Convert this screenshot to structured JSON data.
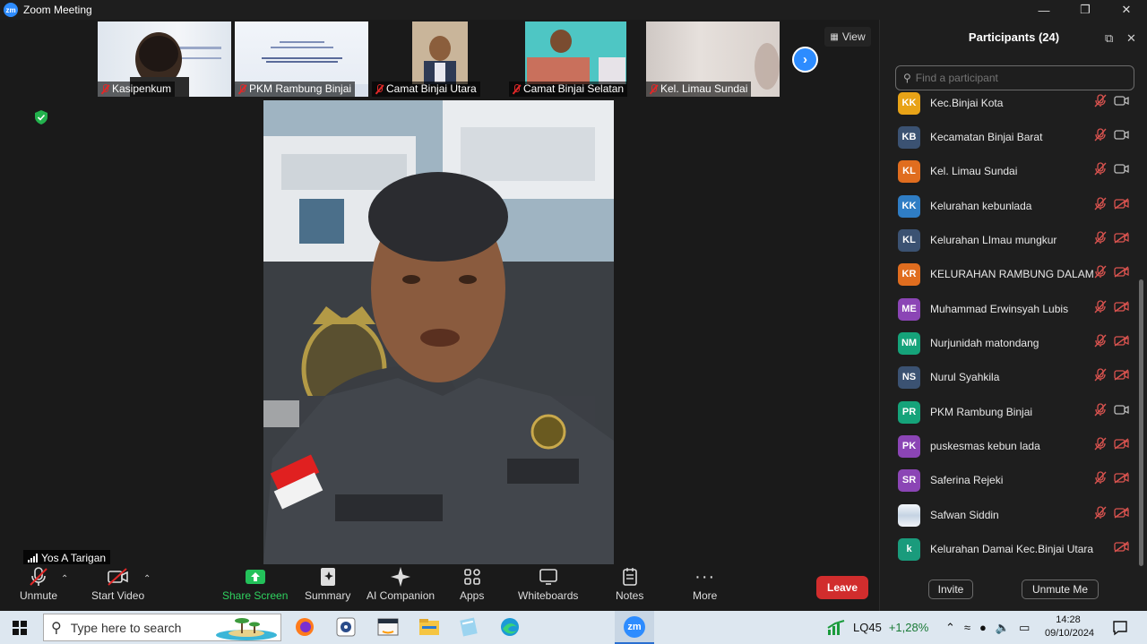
{
  "window": {
    "title": "Zoom Meeting",
    "app_logo": "zm"
  },
  "thumbnails": [
    {
      "name": "Kasipenkum"
    },
    {
      "name": "PKM Rambung Binjai"
    },
    {
      "name": "Camat Binjai Utara"
    },
    {
      "name": "Camat Binjai Selatan"
    },
    {
      "name": "Kel. Limau Sundai"
    }
  ],
  "view_button": {
    "label": "View"
  },
  "main_speaker": {
    "name": "Yos A Tarigan"
  },
  "toolbar": {
    "unmute": "Unmute",
    "start_video": "Start Video",
    "share_screen": "Share Screen",
    "summary": "Summary",
    "ai_companion": "AI Companion",
    "apps": "Apps",
    "whiteboards": "Whiteboards",
    "notes": "Notes",
    "more": "More",
    "leave": "Leave"
  },
  "participants_panel": {
    "title": "Participants (24)",
    "search_placeholder": "Find a participant",
    "invite": "Invite",
    "unmute_me": "Unmute Me",
    "participants": [
      {
        "initials": "KK",
        "name": "Kec.Binjai Kota",
        "color": "#e8a317",
        "video": "on"
      },
      {
        "initials": "KB",
        "name": "Kecamatan Binjai Barat",
        "color": "#3b5272",
        "video": "on"
      },
      {
        "initials": "KL",
        "name": "Kel. Limau Sundai",
        "color": "#e06d1f",
        "video": "on"
      },
      {
        "initials": "KK",
        "name": "Kelurahan kebunlada",
        "color": "#2f7dc4",
        "video": "off"
      },
      {
        "initials": "KL",
        "name": "Kelurahan LImau mungkur",
        "color": "#3b5272",
        "video": "off"
      },
      {
        "initials": "KR",
        "name": "KELURAHAN RAMBUNG DALAM",
        "color": "#e06d1f",
        "video": "off"
      },
      {
        "initials": "ME",
        "name": "Muhammad Erwinsyah Lubis",
        "color": "#8b45b5",
        "video": "off"
      },
      {
        "initials": "NM",
        "name": "Nurjunidah matondang",
        "color": "#15a37a",
        "video": "off"
      },
      {
        "initials": "NS",
        "name": "Nurul Syahkila",
        "color": "#3b5272",
        "video": "off"
      },
      {
        "initials": "PR",
        "name": "PKM Rambung Binjai",
        "color": "#15a37a",
        "video": "on"
      },
      {
        "initials": "PK",
        "name": "puskesmas kebun lada",
        "color": "#8b45b5",
        "video": "off"
      },
      {
        "initials": "SR",
        "name": "Saferina Rejeki",
        "color": "#8b45b5",
        "video": "off"
      },
      {
        "initials": "",
        "name": "Safwan Siddin",
        "color": "#c9d7e6",
        "video": "off"
      },
      {
        "initials": "k",
        "name": "Kelurahan Damai Kec.Binjai Utara",
        "color": "#1a9b7c",
        "video": "off"
      }
    ]
  },
  "taskbar": {
    "search_placeholder": "Type here to search",
    "stock_name": "LQ45",
    "stock_change": "+1,28%",
    "time": "14:28",
    "date": "09/10/2024",
    "zoom_label": "zm"
  }
}
